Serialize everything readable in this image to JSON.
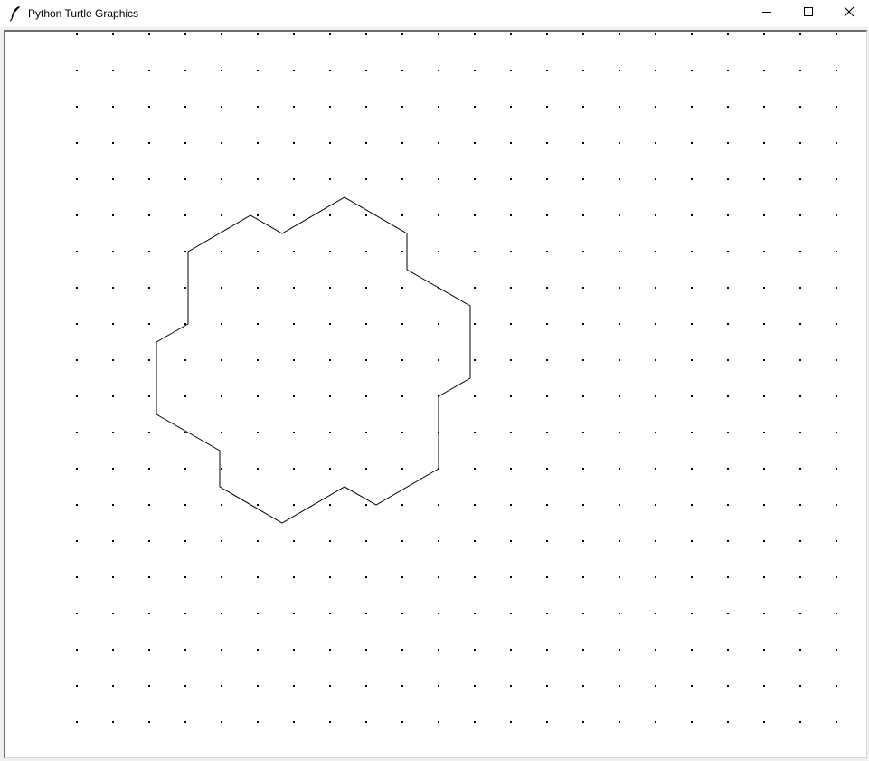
{
  "window": {
    "title": "Python Turtle Graphics",
    "app_icon": "feather-icon",
    "controls": {
      "minimize": "minimize-icon",
      "maximize": "maximize-icon",
      "close": "close-icon"
    }
  },
  "canvas": {
    "background": "#ffffff",
    "dot_color": "#000000",
    "line_color": "#000000"
  }
}
